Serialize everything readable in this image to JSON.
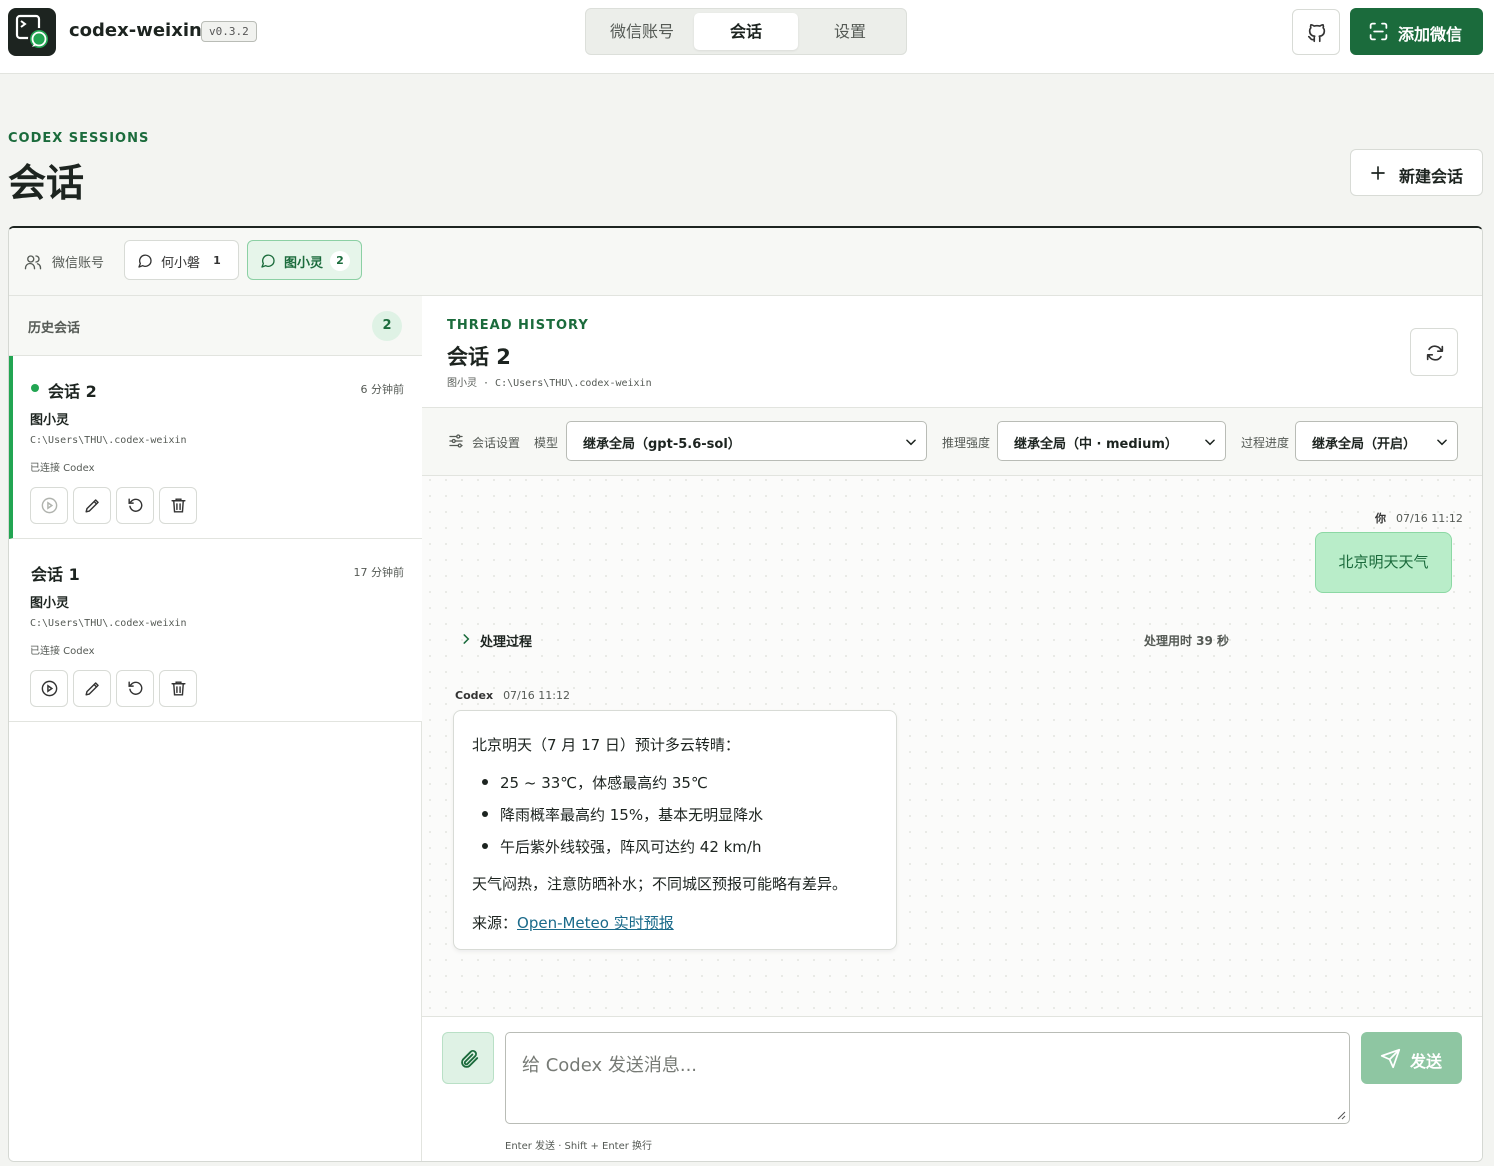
{
  "app": {
    "name": "codex-weixin",
    "version": "v0.3.2"
  },
  "nav": {
    "tabs": [
      {
        "label": "微信账号",
        "active": false
      },
      {
        "label": "会话",
        "active": true
      },
      {
        "label": "设置",
        "active": false
      }
    ]
  },
  "header": {
    "github_icon": "github-icon",
    "add_wechat_label": "添加微信",
    "add_wechat_icon": "scan-icon"
  },
  "page": {
    "eyebrow": "CODEX SESSIONS",
    "title": "会话",
    "new_session_label": "新建会话"
  },
  "accounts": {
    "label": "微信账号",
    "chips": [
      {
        "name": "何小磐",
        "count": "1",
        "active": false
      },
      {
        "name": "图小灵",
        "count": "2",
        "active": true
      }
    ]
  },
  "history": {
    "title": "历史会话",
    "count": "2",
    "sessions": [
      {
        "title": "会话 2",
        "time": "6 分钟前",
        "agent": "图小灵",
        "path": "C:\\Users\\THU\\.codex-weixin",
        "status": "已连接 Codex",
        "active": true
      },
      {
        "title": "会话 1",
        "time": "17 分钟前",
        "agent": "图小灵",
        "path": "C:\\Users\\THU\\.codex-weixin",
        "status": "已连接 Codex",
        "active": false
      }
    ]
  },
  "thread": {
    "eyebrow": "THREAD HISTORY",
    "title": "会话 2",
    "subtitle": "图小灵 · C:\\Users\\THU\\.codex-weixin",
    "settings": {
      "label": "会话设置",
      "model_label": "模型",
      "model_value": "继承全局（gpt-5.6-sol）",
      "reasoning_label": "推理强度",
      "reasoning_value": "继承全局（中 · medium）",
      "progress_label": "过程进度",
      "progress_value": "继承全局（开启）"
    },
    "messages": {
      "user": {
        "author": "你",
        "time": "07/16 11:12",
        "text": "北京明天天气"
      },
      "process": {
        "label": "处理过程",
        "duration": "处理用时 39 秒"
      },
      "bot": {
        "author": "Codex",
        "time": "07/16 11:12",
        "intro": "北京明天（7 月 17 日）预计多云转晴：",
        "bullets": [
          "25 ~ 33℃，体感最高约 35℃",
          "降雨概率最高约 15%，基本无明显降水",
          "午后紫外线较强，阵风可达约 42 km/h"
        ],
        "note": "天气闷热，注意防晒补水；不同城区预报可能略有差异。",
        "source_prefix": "来源：",
        "source_link": "Open-Meteo 实时预报"
      }
    },
    "composer": {
      "placeholder": "给 Codex 发送消息...",
      "send_label": "发送",
      "hint": "Enter 发送 · Shift + Enter 换行"
    }
  },
  "colors": {
    "brand": "#1b6b3c",
    "accent": "#22a552",
    "user_bubble": "#b9edc9",
    "send_disabled": "#8ec6a2"
  }
}
